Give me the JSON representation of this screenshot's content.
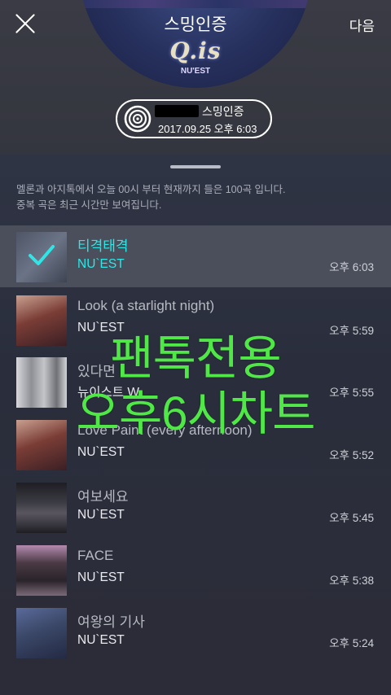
{
  "header": {
    "title": "스밍인증",
    "next_label": "다음",
    "album_logo": "Q.is",
    "album_brand": "NU'EST"
  },
  "cert": {
    "label": "스밍인증",
    "datetime": "2017.09.25 오후 6:03"
  },
  "info": {
    "line1": "멜론과 아지톡에서 오늘 00시 부터 현재까지 들은 100곡 입니다.",
    "line2": "중복 곡은 최근 시간만 보여집니다."
  },
  "overlay": {
    "line1": "팬톡전용",
    "line2": "오후6시차트"
  },
  "tracks": [
    {
      "title": "티격태격",
      "artist": "NU`EST",
      "time": "오후 6:03",
      "color": "#5a6170"
    },
    {
      "title": "Look (a starlight night)",
      "artist": "NU`EST",
      "time": "오후 5:59",
      "color": "#7a3d36"
    },
    {
      "title": "있다면",
      "artist": "뉴이스트 W",
      "time": "오후 5:55",
      "color": "#9a9ca3"
    },
    {
      "title": "Love Paint (every afternoon)",
      "artist": "NU`EST",
      "time": "오후 5:52",
      "color": "#7a3d36"
    },
    {
      "title": "여보세요",
      "artist": "NU`EST",
      "time": "오후 5:45",
      "color": "#2e2e33"
    },
    {
      "title": "FACE",
      "artist": "NU`EST",
      "time": "오후 5:38",
      "color": "#4a3a44"
    },
    {
      "title": "여왕의 기사",
      "artist": "NU`EST",
      "time": "오후 5:24",
      "color": "#3b4868"
    }
  ]
}
